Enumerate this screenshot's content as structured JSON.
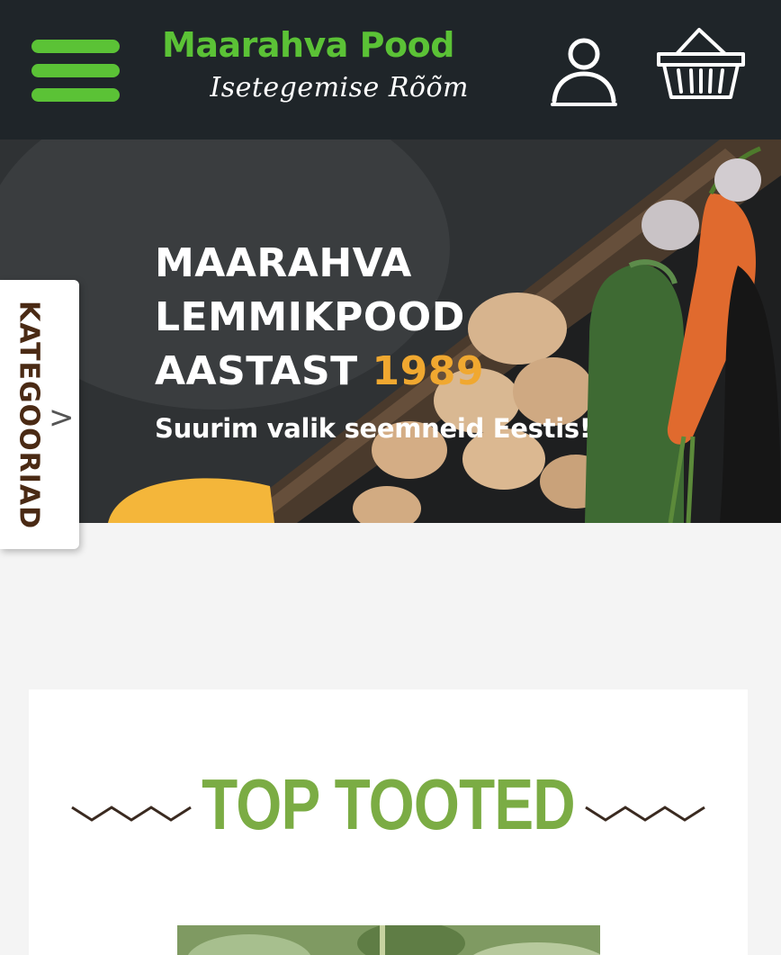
{
  "header": {
    "logo_title": "Maarahva Pood",
    "logo_tagline": "Isetegemise Rõõm",
    "icons": {
      "menu": "hamburger-menu-icon",
      "user": "user-icon",
      "cart": "basket-icon"
    }
  },
  "hero": {
    "heading_line1": "MAARAHVA",
    "heading_line2": "LEMMIKPOOD",
    "heading_line3_prefix": "AASTAST",
    "heading_year": "1989",
    "subheading": "Suurim valik seemneid Eestis!"
  },
  "categories_tab": {
    "label": "KATEGOORIAD",
    "arrow": ">"
  },
  "top_products": {
    "title": "TOP TOOTED"
  },
  "colors": {
    "header_bg": "#1f2529",
    "brand_green": "#5bc236",
    "title_green": "#7bac44",
    "accent_orange": "#f0a830",
    "category_text": "#4a2a14"
  }
}
